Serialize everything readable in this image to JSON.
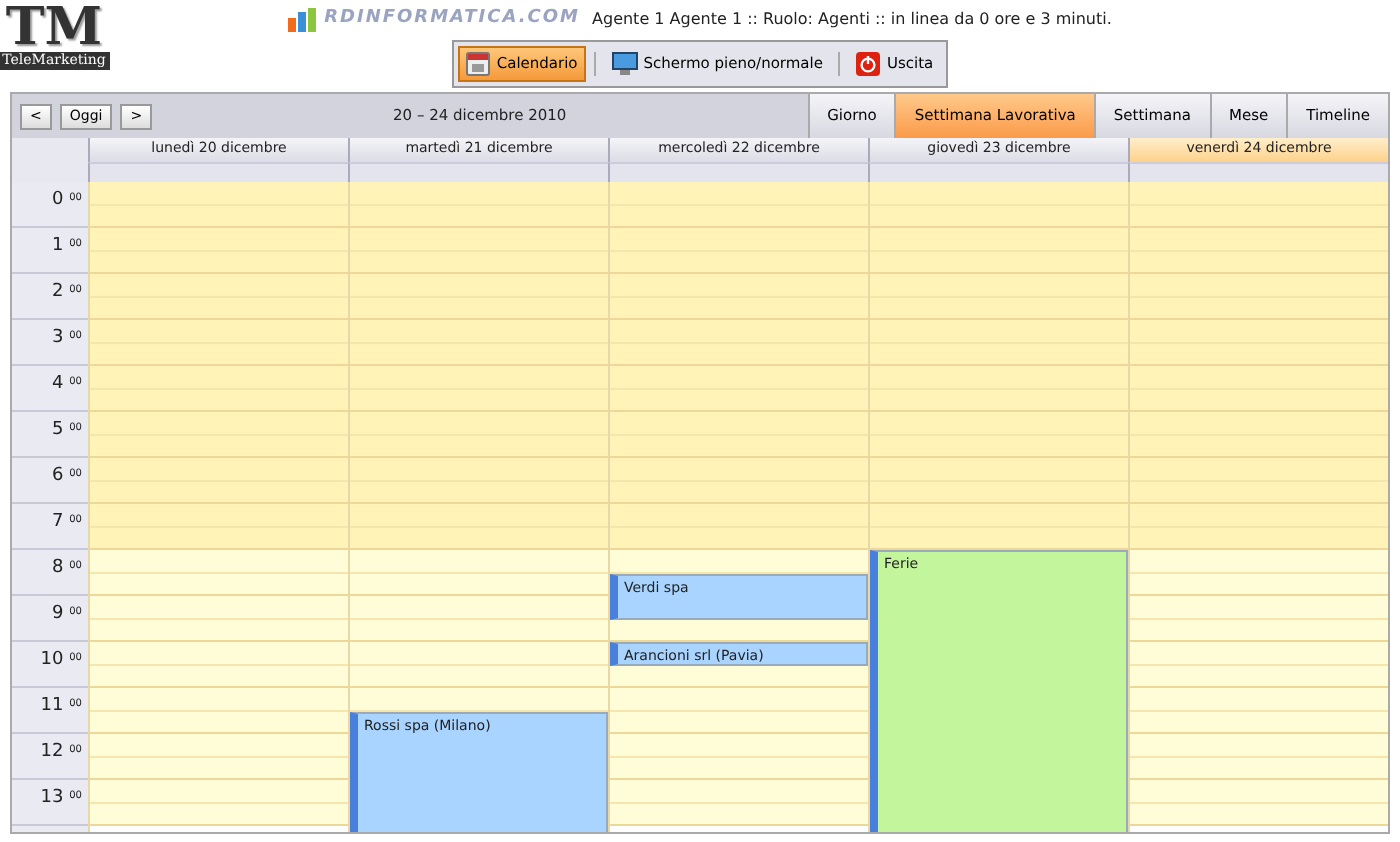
{
  "logo": {
    "initials": "TM",
    "name": "TeleMarketing"
  },
  "brand": {
    "text": "RDINFORMATICA.COM"
  },
  "agent_info": "Agente 1 Agente 1 :: Ruolo: Agenti :: in linea da 0 ore e 3 minuti.",
  "toolbar": [
    {
      "label": "Calendario",
      "kind": "calendar",
      "selected": true
    },
    {
      "label": "Schermo pieno/normale",
      "kind": "screen",
      "selected": false
    },
    {
      "label": "Uscita",
      "kind": "exit",
      "selected": false
    }
  ],
  "nav": {
    "prev": "<",
    "today": "Oggi",
    "next": ">"
  },
  "range_title": "20 – 24 dicembre 2010",
  "views": [
    {
      "label": "Giorno",
      "selected": false
    },
    {
      "label": "Settimana Lavorativa",
      "selected": true
    },
    {
      "label": "Settimana",
      "selected": false
    },
    {
      "label": "Mese",
      "selected": false
    },
    {
      "label": "Timeline",
      "selected": false
    }
  ],
  "days": [
    {
      "label": "lunedì 20 dicembre",
      "today": false
    },
    {
      "label": "martedì 21 dicembre",
      "today": false,
      "events": [
        {
          "title": "Rossi spa (Milano)",
          "color": "#a8d4ff"
        }
      ]
    },
    {
      "label": "mercoledì 22 dicembre",
      "today": false,
      "events": [
        {
          "title": "Verdi spa",
          "color": "#a8d4ff"
        },
        {
          "title": "Arancioni srl (Pavia)",
          "color": "#a8d4ff"
        }
      ]
    },
    {
      "label": "giovedì 23 dicembre",
      "today": false,
      "events": [
        {
          "title": "Ferie",
          "color": "#c2f59c"
        }
      ]
    },
    {
      "label": "venerdì 24 dicembre",
      "today": true
    }
  ],
  "hours": [
    {
      "hour": "0",
      "minutes": "00",
      "working": false
    },
    {
      "hour": "1",
      "minutes": "00",
      "working": false
    },
    {
      "hour": "2",
      "minutes": "00",
      "working": false
    },
    {
      "hour": "3",
      "minutes": "00",
      "working": false
    },
    {
      "hour": "4",
      "minutes": "00",
      "working": false
    },
    {
      "hour": "5",
      "minutes": "00",
      "working": false
    },
    {
      "hour": "6",
      "minutes": "00",
      "working": false
    },
    {
      "hour": "7",
      "minutes": "00",
      "working": false
    },
    {
      "hour": "8",
      "minutes": "00",
      "working": true
    },
    {
      "hour": "9",
      "minutes": "00",
      "working": true
    },
    {
      "hour": "10",
      "minutes": "00",
      "working": true
    },
    {
      "hour": "11",
      "minutes": "00",
      "working": true
    },
    {
      "hour": "12",
      "minutes": "00",
      "working": true
    },
    {
      "hour": "13",
      "minutes": "00",
      "working": true
    }
  ]
}
